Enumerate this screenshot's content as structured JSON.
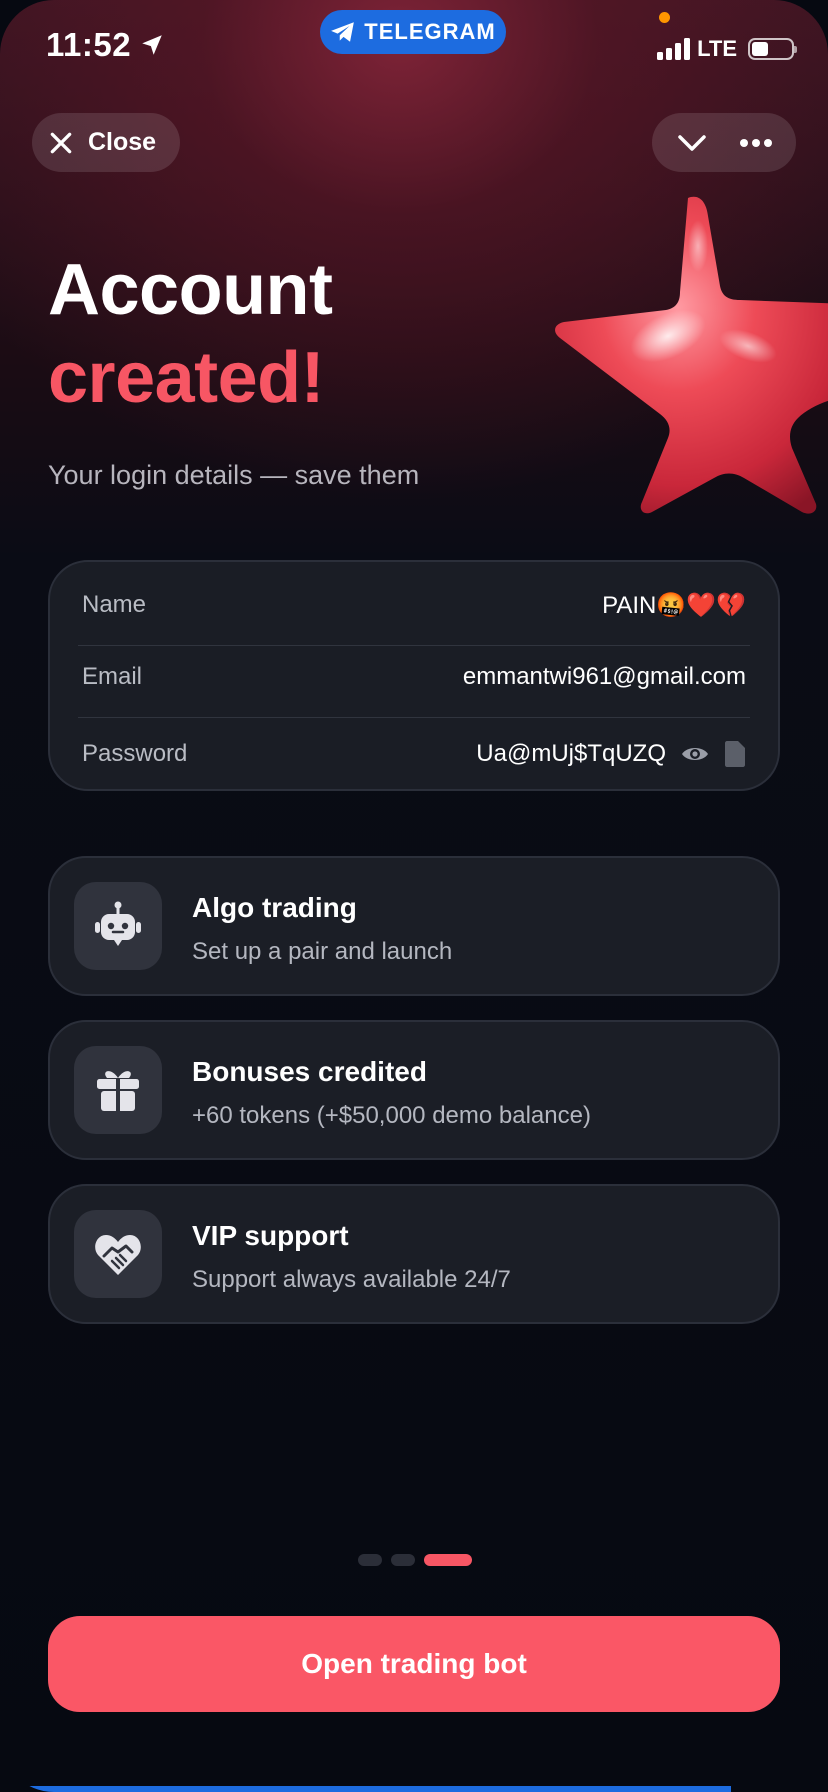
{
  "status_bar": {
    "time": "11:52",
    "telegram_label": "TELEGRAM",
    "network": "LTE"
  },
  "nav": {
    "close_label": "Close"
  },
  "heading": {
    "line1": "Account",
    "line2": "created!",
    "subtitle": "Your login details — save them"
  },
  "credentials": {
    "name_label": "Name",
    "name_value": "PAIN🤬❤️💔",
    "email_label": "Email",
    "email_value": "emmantwi961@gmail.com",
    "password_label": "Password",
    "password_value": "Ua@mUj$TqUZQ"
  },
  "features": [
    {
      "title": "Algo trading",
      "description": "Set up a pair and launch",
      "icon": "robot-icon"
    },
    {
      "title": "Bonuses credited",
      "description": "+60 tokens (+$50,000 demo balance)",
      "icon": "gift-icon"
    },
    {
      "title": "VIP support",
      "description": "Support always available 24/7",
      "icon": "handshake-heart-icon"
    }
  ],
  "pagination": {
    "total": 3,
    "active_index": 2
  },
  "cta": {
    "label": "Open trading bot"
  },
  "colors": {
    "accent": "#fa5766",
    "telegram_blue": "#1d6ce0",
    "card_bg": "#1b1e26",
    "background": "#060911"
  }
}
